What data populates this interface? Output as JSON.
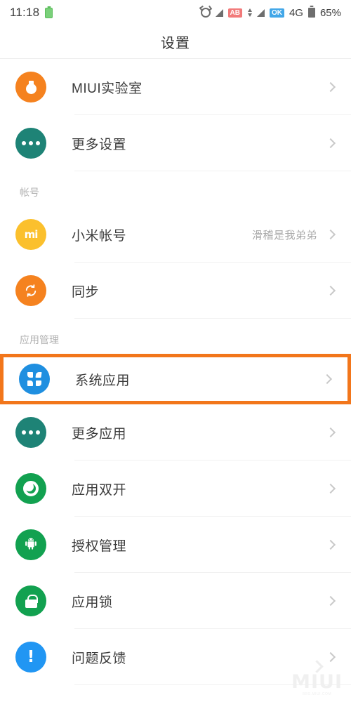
{
  "status_bar": {
    "time": "11:18",
    "left_icons": [
      "battery-green-icon"
    ],
    "right_icons": [
      "alarm-icon",
      "signal-icon",
      "ab-badge",
      "data-updown-icon",
      "signal-icon",
      "ok-badge"
    ],
    "ab_badge": "AB",
    "ok_badge": "OK",
    "network": "4G",
    "battery_percent": "65%"
  },
  "header": {
    "title": "设置"
  },
  "list": [
    {
      "type": "row",
      "label": "MIUI实验室",
      "value": "",
      "icon": "flask-icon",
      "icon_color": "#f5821f",
      "chevron": true
    },
    {
      "type": "row",
      "label": "更多设置",
      "value": "",
      "icon": "dots-icon",
      "icon_color": "#1e8376",
      "chevron": true
    },
    {
      "type": "section",
      "label": "帐号"
    },
    {
      "type": "row",
      "label": "小米帐号",
      "value": "滑稽是我弟弟",
      "icon": "mi-logo-icon",
      "icon_color": "#fbc02d",
      "chevron": true
    },
    {
      "type": "row",
      "label": "同步",
      "value": "",
      "icon": "sync-icon",
      "icon_color": "#f5821f",
      "chevron": true
    },
    {
      "type": "section",
      "label": "应用管理"
    },
    {
      "type": "row",
      "label": "系统应用",
      "value": "",
      "icon": "grid-apps-icon",
      "icon_color": "#1f8fe0",
      "chevron": true,
      "highlighted": true
    },
    {
      "type": "row",
      "label": "更多应用",
      "value": "",
      "icon": "dots-icon",
      "icon_color": "#1e8376",
      "chevron": true
    },
    {
      "type": "row",
      "label": "应用双开",
      "value": "",
      "icon": "dual-app-icon",
      "icon_color": "#12a150",
      "chevron": true
    },
    {
      "type": "row",
      "label": "授权管理",
      "value": "",
      "icon": "android-robot-icon",
      "icon_color": "#12a150",
      "chevron": true
    },
    {
      "type": "row",
      "label": "应用锁",
      "value": "",
      "icon": "lock-icon",
      "icon_color": "#12a150",
      "chevron": true
    },
    {
      "type": "row",
      "label": "问题反馈",
      "value": "",
      "icon": "exclamation-icon",
      "icon_color": "#2196f3",
      "chevron": true
    }
  ],
  "watermark": {
    "main": "MIUI",
    "sub": "BBS.MIUI.COM"
  },
  "colors": {
    "highlight_border": "#f2761b",
    "accent_orange": "#f5821f",
    "accent_green": "#12a150",
    "accent_teal": "#1e8376",
    "accent_blue": "#1f8fe0"
  }
}
